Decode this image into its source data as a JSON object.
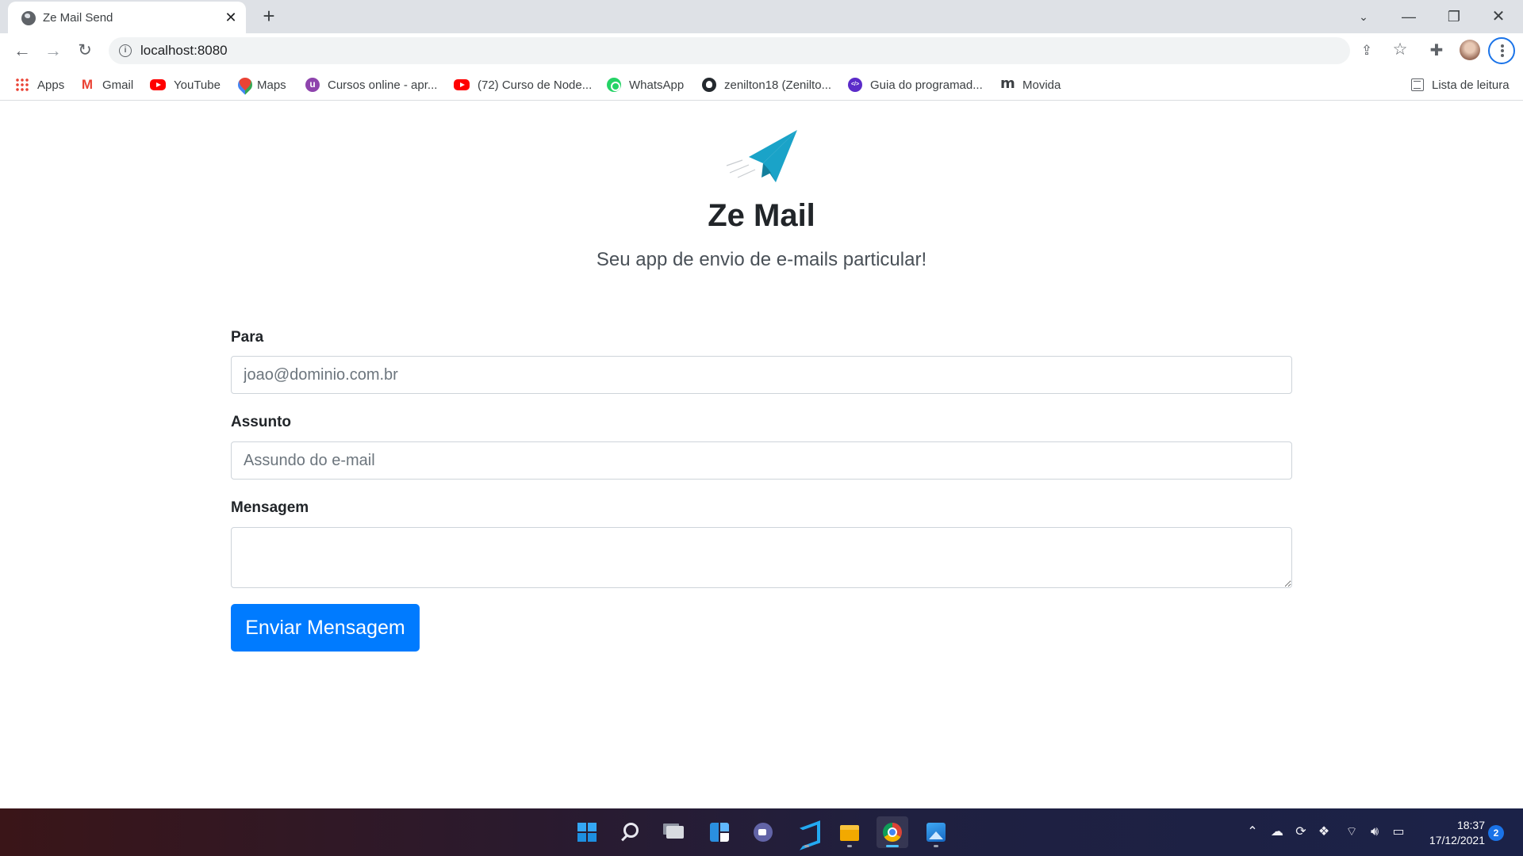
{
  "browser": {
    "tab_title": "Ze Mail Send",
    "url": "localhost:8080",
    "bookmarks": [
      {
        "label": "Apps",
        "icon": "apps-grid-icon"
      },
      {
        "label": "Gmail",
        "icon": "gmail-icon"
      },
      {
        "label": "YouTube",
        "icon": "youtube-icon"
      },
      {
        "label": "Maps",
        "icon": "maps-icon"
      },
      {
        "label": "Cursos online - apr...",
        "icon": "udemy-icon"
      },
      {
        "label": "(72) Curso de Node...",
        "icon": "youtube-icon"
      },
      {
        "label": "WhatsApp",
        "icon": "whatsapp-icon"
      },
      {
        "label": "zenilton18 (Zenilto...",
        "icon": "github-icon"
      },
      {
        "label": "Guia do programad...",
        "icon": "guia-icon"
      },
      {
        "label": "Movida",
        "icon": "movida-icon"
      }
    ],
    "reading_list": "Lista de leitura"
  },
  "page": {
    "title": "Ze Mail",
    "subtitle": "Seu app de envio de e-mails particular!",
    "form": {
      "to_label": "Para",
      "to_placeholder": "joao@dominio.com.br",
      "subject_label": "Assunto",
      "subject_placeholder": "Assundo do e-mail",
      "message_label": "Mensagem",
      "message_value": "",
      "submit_label": "Enviar Mensagem"
    },
    "colors": {
      "accent": "#007bff",
      "logo": "#1aa3c8"
    }
  },
  "taskbar": {
    "apps": [
      "start",
      "search",
      "task-view",
      "widgets",
      "teams",
      "vscode",
      "file-explorer",
      "chrome",
      "photos"
    ],
    "active_app": "chrome",
    "clock_time": "18:37",
    "clock_date": "17/12/2021",
    "notification_count": "2"
  }
}
